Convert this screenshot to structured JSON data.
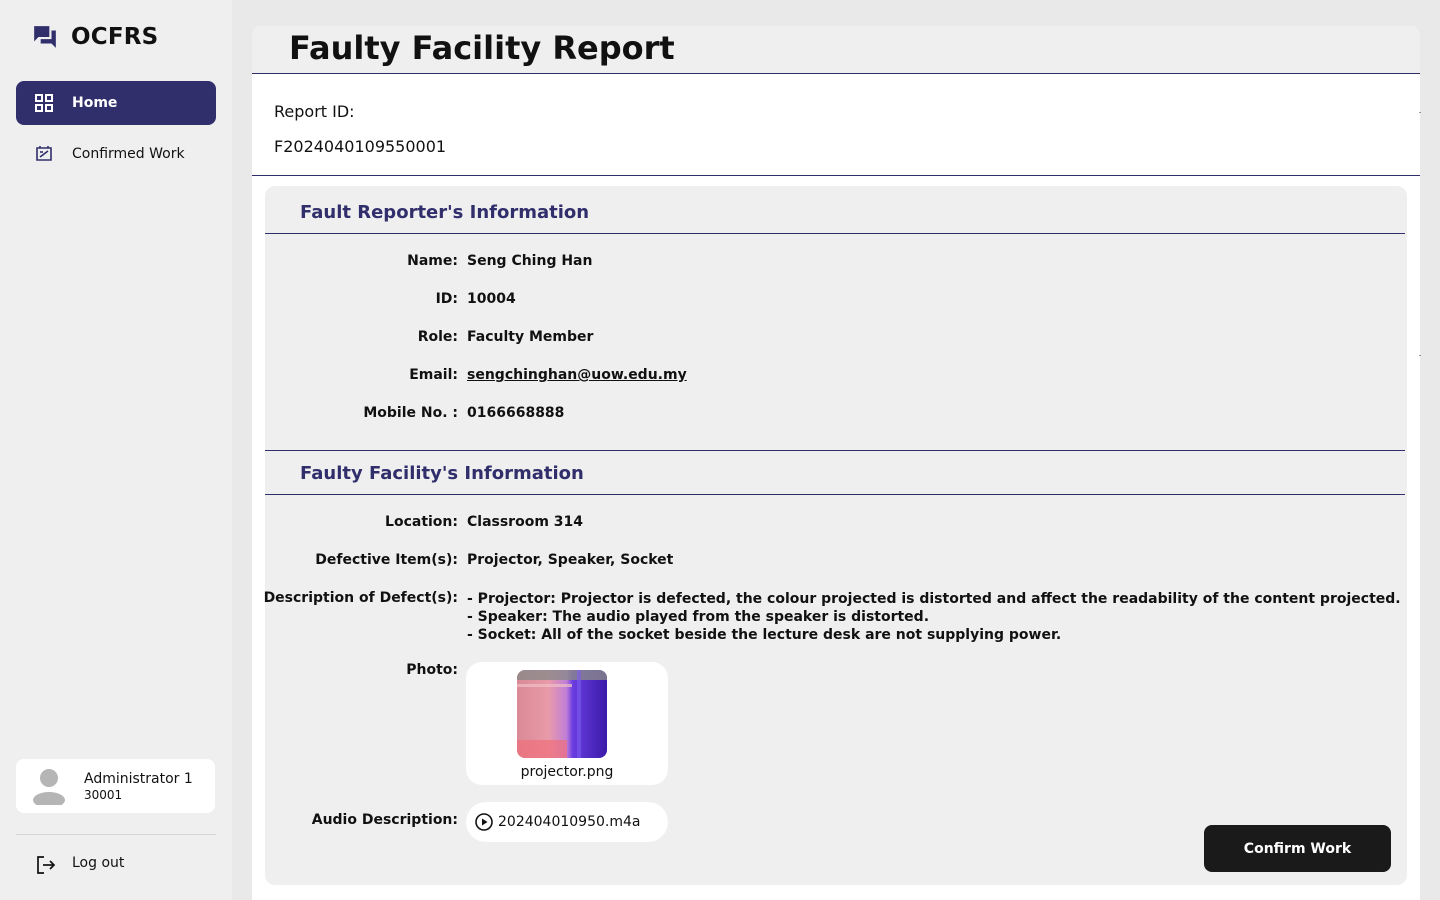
{
  "sidebar": {
    "brand": "OCFRS",
    "nav": [
      {
        "label": "Home",
        "active": true,
        "icon": "grid-icon"
      },
      {
        "label": "Confirmed Work",
        "active": false,
        "icon": "document-edit-icon"
      }
    ],
    "user": {
      "name": "Administrator 1",
      "id": "30001"
    },
    "logout_label": "Log out"
  },
  "main": {
    "title": "Faulty Facility Report",
    "report_id_label": "Report ID:",
    "report_id": "F2024040109550001",
    "reporter": {
      "heading": "Fault Reporter's Information",
      "fields": [
        {
          "label": "Name:",
          "value": "Seng Ching Han"
        },
        {
          "label": "ID:",
          "value": "10004"
        },
        {
          "label": "Role:",
          "value": "Faculty Member"
        },
        {
          "label": "Email:",
          "value": "sengchinghan@uow.edu.my"
        },
        {
          "label": "Mobile No. :",
          "value": "0166668888"
        }
      ]
    },
    "facility": {
      "heading": "Faulty Facility's Information",
      "location_label": "Location:",
      "location": "Classroom 314",
      "items_label": "Defective Item(s):",
      "items": "Projector, Speaker, Socket",
      "description_label": "Description of Defect(s):",
      "description_lines": [
        "- Projector: Projector is defected, the colour projected is distorted and affect the readability of the content projected.",
        "- Speaker: The audio played from the speaker is distorted.",
        "- Socket: All of the socket beside the lecture desk are not supplying power."
      ],
      "photo_label": "Photo:",
      "photo_name": "projector.png",
      "audio_label": "Audio Description:",
      "audio_name": "202404010950.m4a"
    },
    "confirm_label": "Confirm Work"
  },
  "colors": {
    "accent": "#302e6b",
    "button": "#1a1a1a",
    "background": "#efefef"
  }
}
